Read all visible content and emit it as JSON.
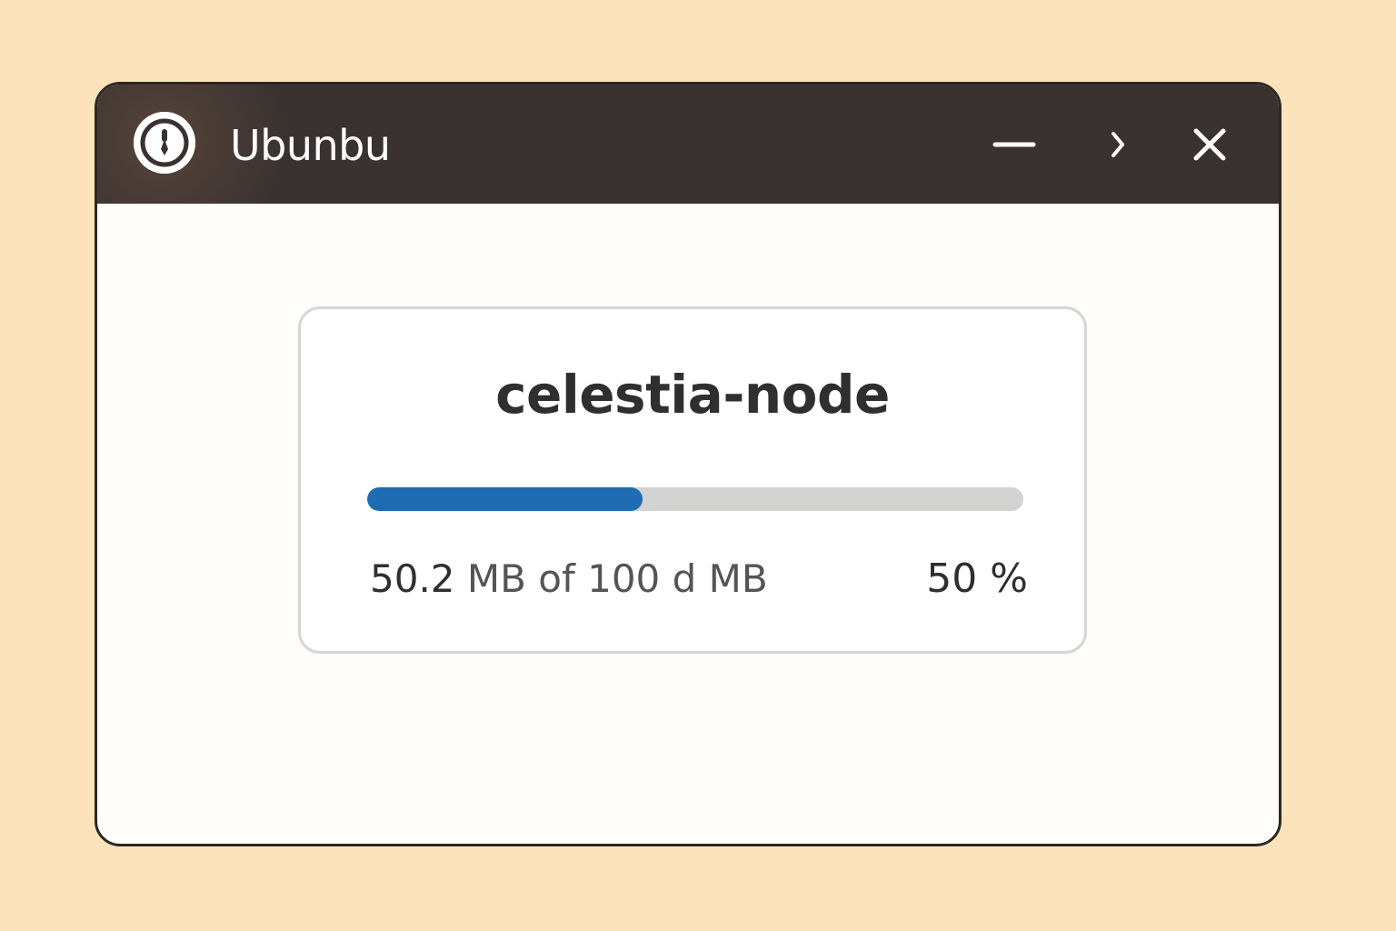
{
  "window": {
    "title": "Ubunbu",
    "app_icon": "app-logo-icon",
    "controls": {
      "minimize_icon": "minimize-icon",
      "forward_icon": "chevron-right-icon",
      "close_icon": "close-icon"
    }
  },
  "download": {
    "name": "celestia-node",
    "progress_fraction": 0.42,
    "downloaded": "50.2",
    "size_suffix": "MB of 100 d MB",
    "percent_label": "50 %"
  },
  "colors": {
    "background": "#fde3bb",
    "titlebar": "#3a3230",
    "progress_fill": "#1e6cb3",
    "progress_track": "#d3d3d1"
  }
}
